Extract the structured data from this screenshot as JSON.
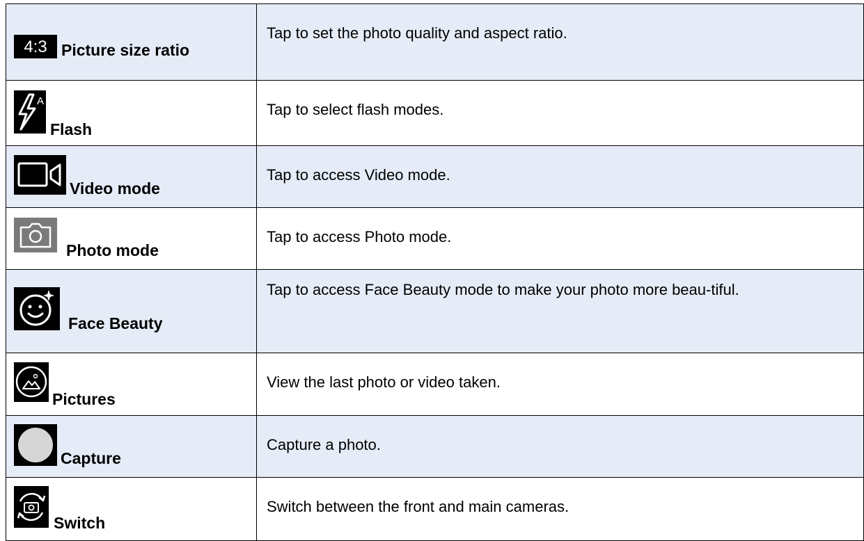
{
  "rows": [
    {
      "label": "Picture size ratio",
      "icon": "aspect-ratio-4-3-icon",
      "icon_text": "4:3",
      "description": "Tap to set the photo quality and aspect ratio."
    },
    {
      "label": "Flash",
      "icon": "flash-auto-icon",
      "icon_text": "A",
      "description": "Tap to select flash modes."
    },
    {
      "label": "Video mode",
      "icon": "video-camera-icon",
      "description": "Tap to access Video mode."
    },
    {
      "label": "Photo mode",
      "icon": "photo-camera-icon",
      "description": "Tap to access Photo mode."
    },
    {
      "label": "Face Beauty",
      "icon": "face-beauty-icon",
      "description": "Tap to access Face Beauty mode to make your photo more beau-tiful."
    },
    {
      "label": "Pictures",
      "icon": "gallery-icon",
      "description": "View the last photo or video taken."
    },
    {
      "label": "Capture",
      "icon": "shutter-icon",
      "description": "Capture a photo."
    },
    {
      "label": "Switch",
      "icon": "switch-camera-icon",
      "description": "Switch between the front and main cameras."
    }
  ],
  "colors": {
    "shaded_row": "#e6ecf7",
    "border": "#000000",
    "icon_background": "#000000"
  }
}
